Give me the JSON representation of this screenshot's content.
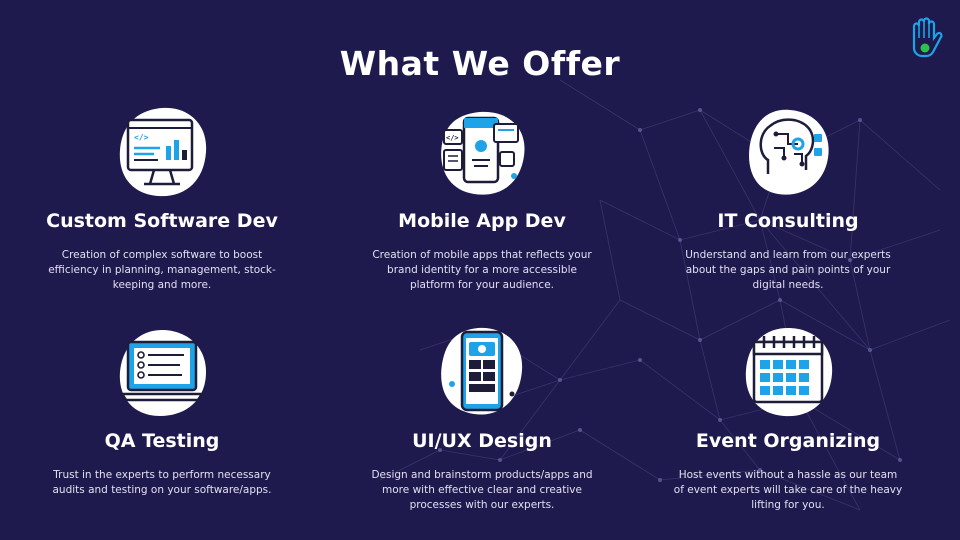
{
  "page": {
    "title": "What We Offer",
    "colors": {
      "background": "#1e1a4d",
      "accent": "#1fa3e8",
      "icon_dark": "#1d1d3a",
      "logo_green": "#2fbf4b"
    }
  },
  "logo": {
    "icon": "hand-logo-icon"
  },
  "services": [
    {
      "icon": "code-monitor-icon",
      "name": "Custom Software Dev",
      "description": "Creation of complex software to boost efficiency in planning, management, stock-keeping and more."
    },
    {
      "icon": "mobile-app-icon",
      "name": "Mobile App Dev",
      "description": "Creation of mobile apps that reflects your brand identity for a more accessible platform for your audience."
    },
    {
      "icon": "brain-circuit-icon",
      "name": "IT Consulting",
      "description": "Understand and learn from our experts about the gaps and pain points of your digital needs."
    },
    {
      "icon": "checklist-laptop-icon",
      "name": "QA Testing",
      "description": "Trust in the experts to perform necessary audits and testing on your software/apps."
    },
    {
      "icon": "phone-layout-icon",
      "name": "UI/UX Design",
      "description": "Design and brainstorm products/apps and more with effective clear and creative processes with our experts."
    },
    {
      "icon": "calendar-icon",
      "name": "Event Organizing",
      "description": "Host events without a hassle as our team of event experts will take care of the heavy lifting for you."
    }
  ]
}
